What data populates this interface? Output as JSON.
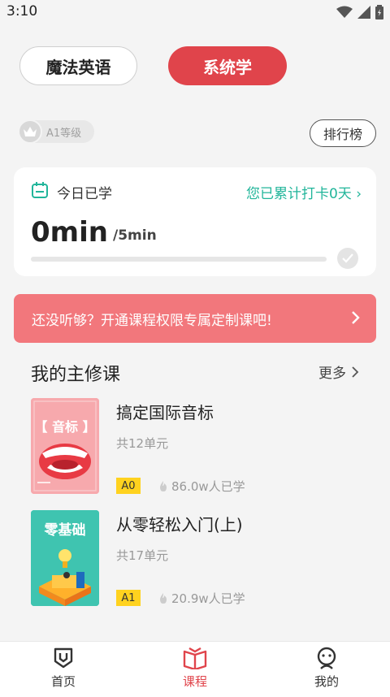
{
  "status_bar": {
    "time": "3:10"
  },
  "tabs": [
    {
      "label": "魔法英语",
      "active": false
    },
    {
      "label": "系统学",
      "active": true
    }
  ],
  "level": {
    "label": "A1等级"
  },
  "rank_button": {
    "label": "排行榜"
  },
  "today_card": {
    "title": "今日已学",
    "streak": "您已累计打卡0天",
    "minutes": "0min",
    "goal": "/5min",
    "progress": 0
  },
  "promo": {
    "text": "还没听够？开通课程权限专属定制课吧!"
  },
  "section": {
    "title": "我的主修课",
    "more": "更多"
  },
  "courses": [
    {
      "name": "搞定国际音标",
      "units": "共12单元",
      "level": "A0",
      "learners": "86.0w人已学",
      "cover_text": "【 音标 】"
    },
    {
      "name": "从零轻松入门(上)",
      "units": "共17单元",
      "level": "A1",
      "learners": "20.9w人已学",
      "cover_text": "零基础"
    }
  ],
  "bottom_nav": [
    {
      "label": "首页",
      "icon": "home-icon",
      "active": false
    },
    {
      "label": "课程",
      "icon": "book-icon",
      "active": true
    },
    {
      "label": "我的",
      "icon": "profile-icon",
      "active": false
    }
  ],
  "colors": {
    "accent": "#e0444b",
    "teal": "#21b59a",
    "promo": "#f2777c",
    "tag": "#ffd21f"
  }
}
